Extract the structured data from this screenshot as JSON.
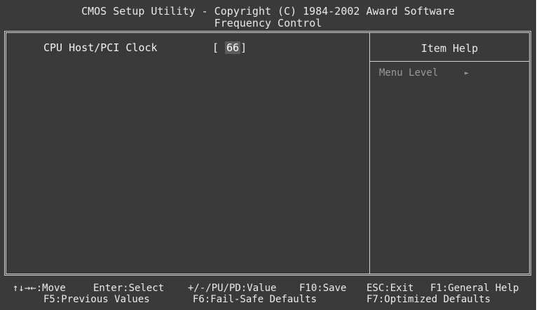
{
  "header": {
    "line1": "CMOS Setup Utility - Copyright (C) 1984-2002 Award Software",
    "line2": "Frequency Control"
  },
  "settings": {
    "items": [
      {
        "label": "CPU Host/PCI Clock",
        "value_prefix": "[ ",
        "value": "66",
        "value_suffix": "]"
      }
    ]
  },
  "help_panel": {
    "title": "Item Help",
    "menu_level_label": "Menu Level",
    "menu_level_arrow": "►"
  },
  "footer": {
    "row1": {
      "move": "↑↓→←:Move",
      "select": "Enter:Select",
      "value": "+/-/PU/PD:Value",
      "save": "F10:Save",
      "exit": "ESC:Exit",
      "help": "F1:General Help"
    },
    "row2": {
      "previous": "F5:Previous Values",
      "failsafe": "F6:Fail-Safe Defaults",
      "optimized": "F7:Optimized Defaults"
    }
  },
  "colors": {
    "background": "#3a3a3a",
    "text": "#e6e6e6",
    "frame": "#cfcfcf",
    "help_dim_text": "#9a9a9a",
    "highlight": "#5c5c5c"
  }
}
